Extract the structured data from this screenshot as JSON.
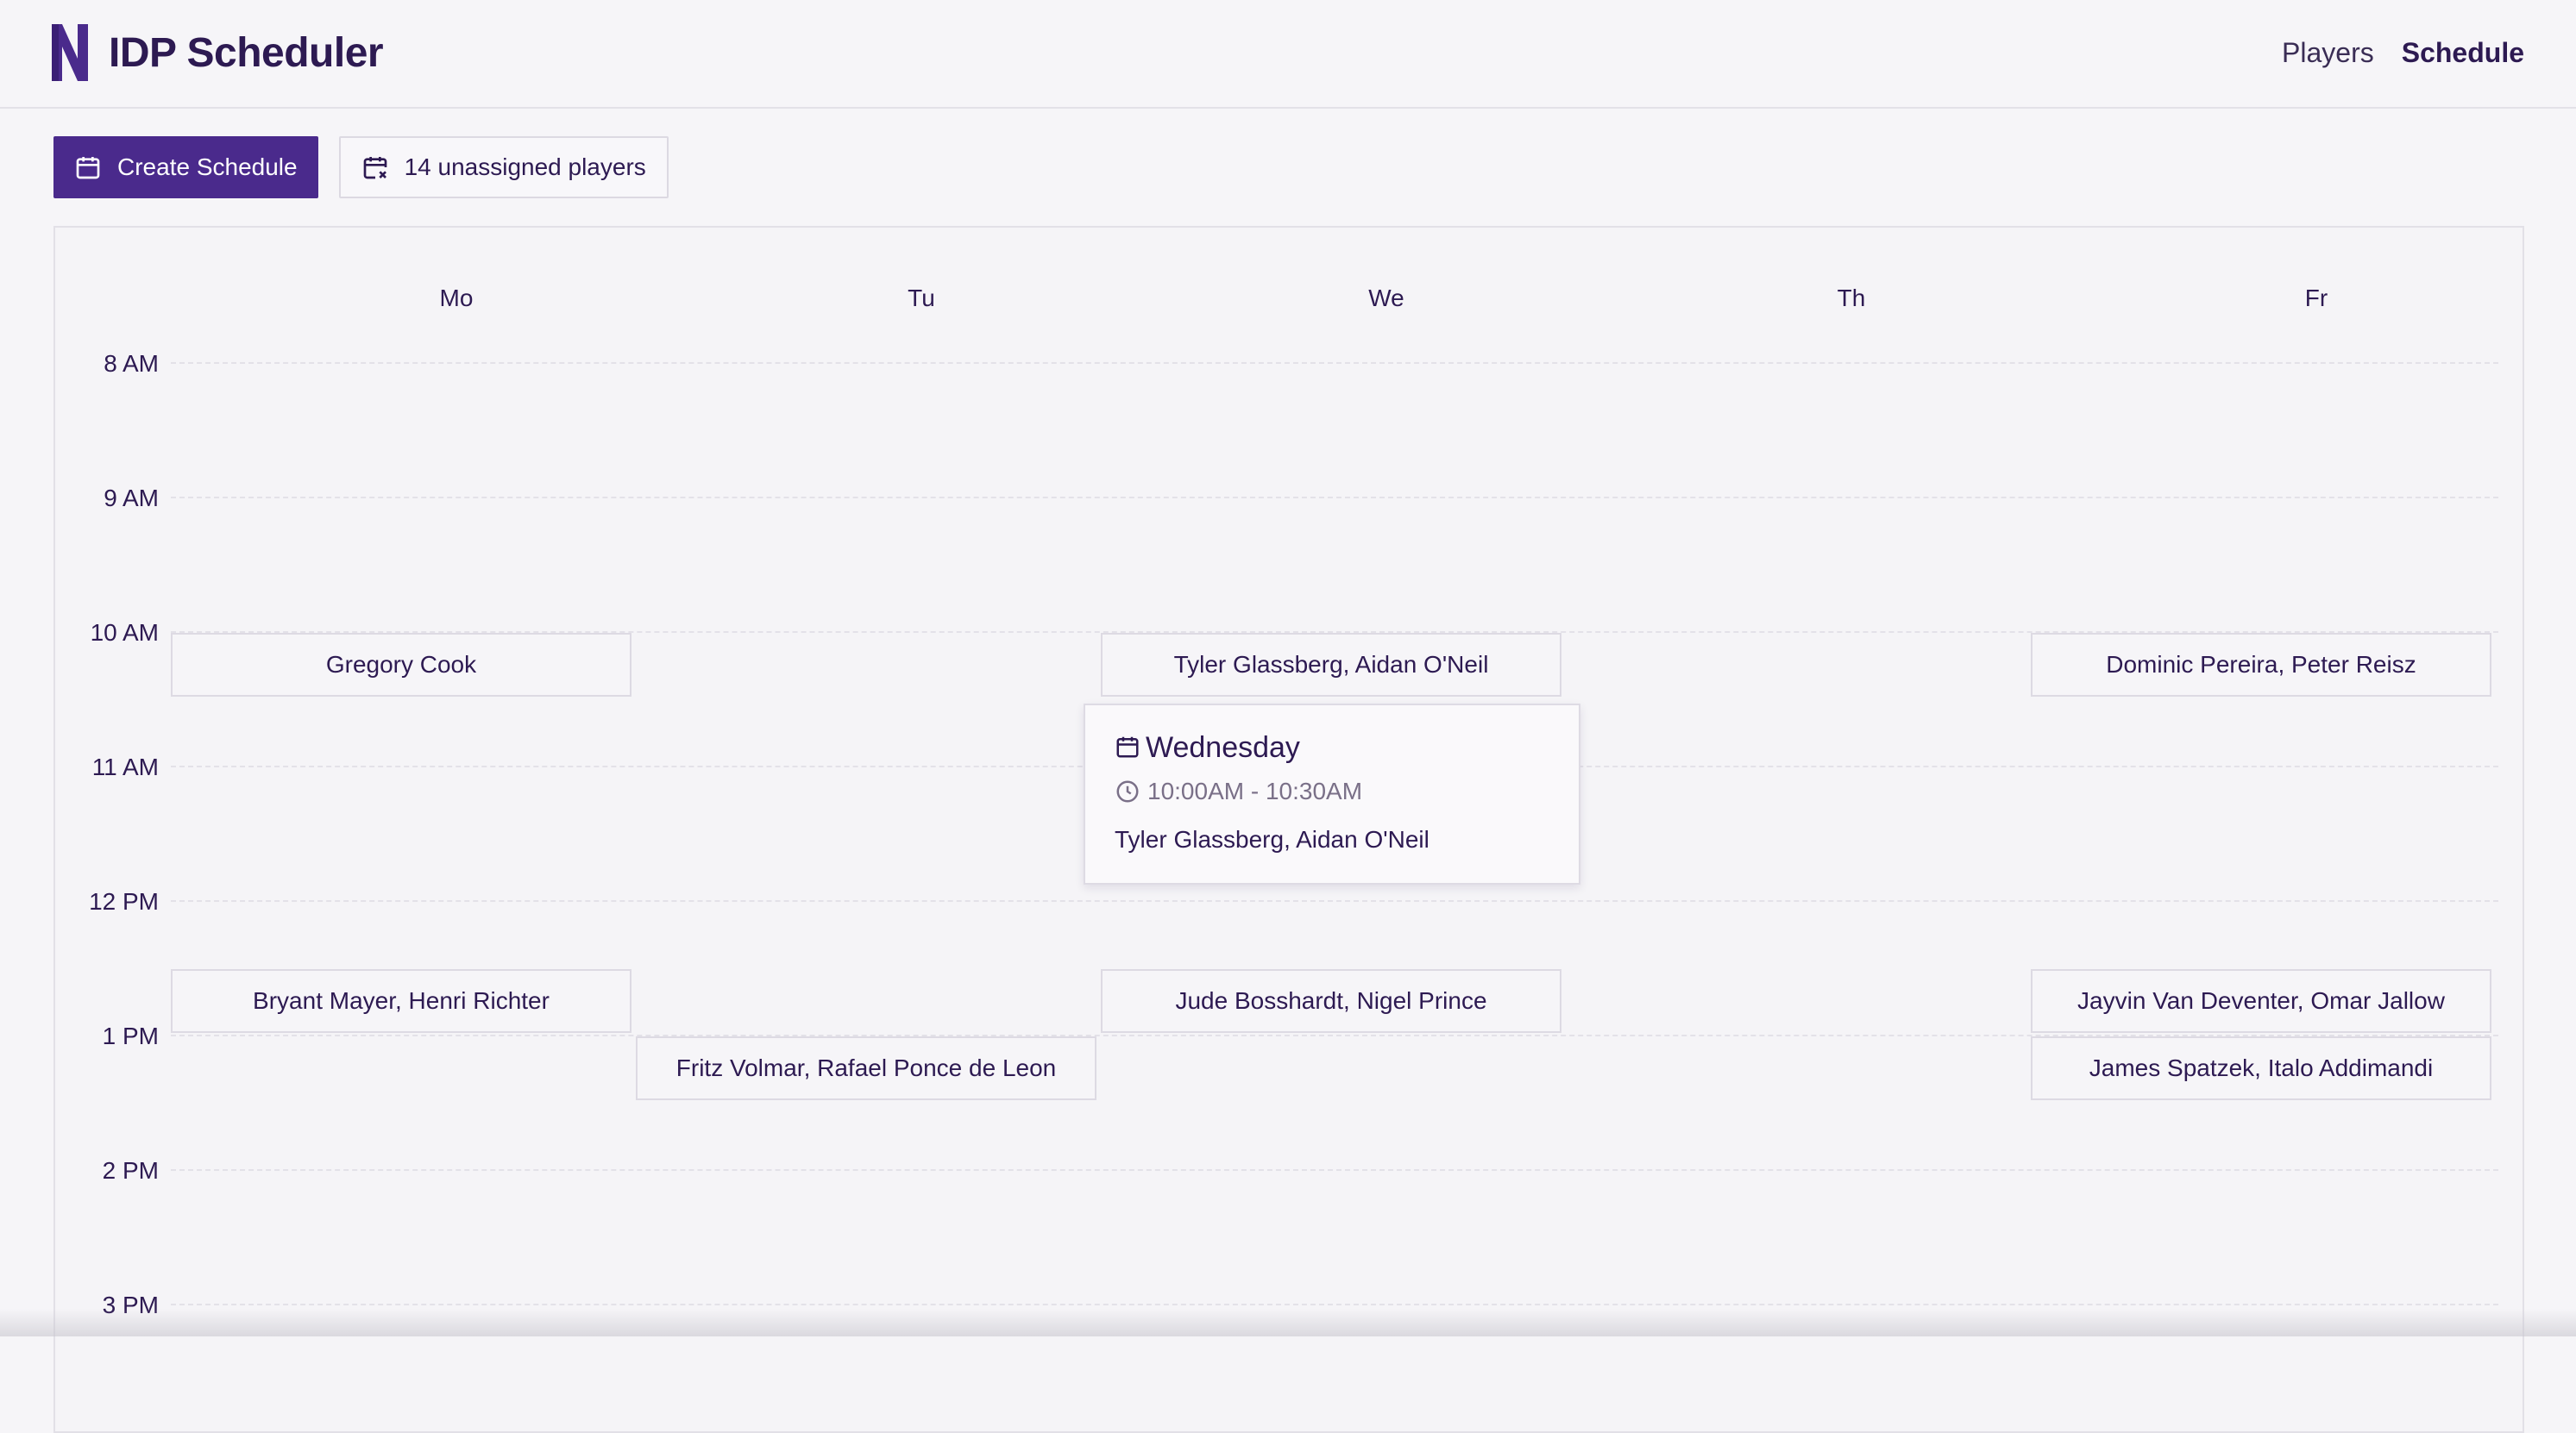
{
  "header": {
    "app_title": "IDP Scheduler",
    "nav": [
      {
        "label": "Players",
        "active": false
      },
      {
        "label": "Schedule",
        "active": true
      }
    ]
  },
  "toolbar": {
    "create_label": "Create Schedule",
    "unassigned_label": "14 unassigned players"
  },
  "calendar": {
    "days": [
      "Mo",
      "Tu",
      "We",
      "Th",
      "Fr"
    ],
    "times": [
      "8 AM",
      "9 AM",
      "10 AM",
      "11 AM",
      "12 PM",
      "1 PM",
      "2 PM",
      "3 PM"
    ],
    "events": [
      {
        "day": "Mo",
        "start": "10:00",
        "label": "Gregory Cook"
      },
      {
        "day": "We",
        "start": "10:00",
        "label": "Tyler Glassberg, Aidan O'Neil"
      },
      {
        "day": "Fr",
        "start": "10:00",
        "label": "Dominic Pereira, Peter Reisz"
      },
      {
        "day": "Mo",
        "start": "12:30",
        "label": "Bryant Mayer, Henri Richter"
      },
      {
        "day": "We",
        "start": "12:30",
        "label": "Jude Bosshardt, Nigel Prince"
      },
      {
        "day": "Fr",
        "start": "12:30",
        "label": "Jayvin Van Deventer, Omar Jallow"
      },
      {
        "day": "Tu",
        "start": "13:00",
        "label": "Fritz Volmar, Rafael Ponce de Leon"
      },
      {
        "day": "Fr",
        "start": "13:00",
        "label": "James Spatzek, Italo Addimandi"
      }
    ]
  },
  "popover": {
    "day": "Wednesday",
    "time": "10:00AM - 10:30AM",
    "players": "Tyler Glassberg, Aidan O'Neil"
  },
  "colors": {
    "brand": "#4a2a8c",
    "text": "#2d1a52",
    "background": "#f6f5f8"
  }
}
